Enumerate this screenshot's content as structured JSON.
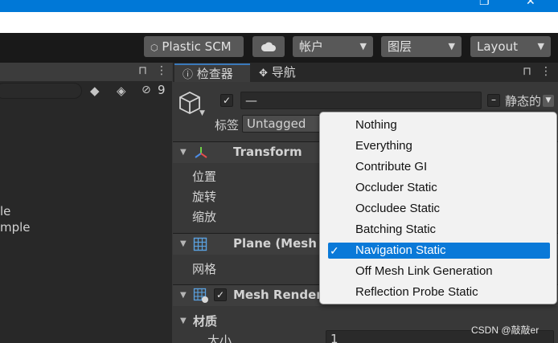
{
  "window": {
    "restore_glyph": "❐",
    "close_glyph": "✕"
  },
  "toolbar": {
    "plastic_label": "Plastic SCM",
    "plastic_icon": "plastic-scm-icon",
    "cloud_icon": "cloud-icon",
    "account_label": "帐户",
    "layers_label": "图层",
    "layout_label": "Layout"
  },
  "hierarchy": {
    "lock_icon": "lock-icon",
    "more_icon": "more-icon",
    "visibility_count": "9",
    "items": [
      "le",
      "mple"
    ]
  },
  "inspector": {
    "tabs": [
      {
        "label": "检查器",
        "icon": "info-icon"
      },
      {
        "label": "导航",
        "icon": "navigation-icon"
      }
    ],
    "object_name": "—",
    "static_label": "静态的",
    "tag_label": "标签",
    "tag_value": "Untagged",
    "components": [
      {
        "name": "Transform",
        "icon": "transform-icon"
      },
      {
        "name": "Plane (Mesh F",
        "icon": "mesh-filter-icon"
      },
      {
        "name": "Mesh Rendere",
        "icon": "mesh-renderer-icon"
      }
    ],
    "transform_fields": [
      "位置",
      "旋转",
      "缩放"
    ],
    "mesh_field": "网格",
    "materials_label": "材质",
    "size_label": "大小",
    "size_value": "1"
  },
  "static_menu": {
    "items": [
      {
        "label": "Nothing",
        "checked": false
      },
      {
        "label": "Everything",
        "checked": false
      },
      {
        "label": "Contribute GI",
        "checked": false
      },
      {
        "label": "Occluder Static",
        "checked": false
      },
      {
        "label": "Occludee Static",
        "checked": false
      },
      {
        "label": "Batching Static",
        "checked": false
      },
      {
        "label": "Navigation Static",
        "checked": true
      },
      {
        "label": "Off Mesh Link Generation",
        "checked": false
      },
      {
        "label": "Reflection Probe Static",
        "checked": false
      }
    ],
    "check_glyph": "✓"
  },
  "watermark": "CSDN @敲敲er",
  "colors": {
    "titlebar": "#0078d7",
    "selection": "#0a79d8",
    "tab_accent": "#3a79bb"
  }
}
